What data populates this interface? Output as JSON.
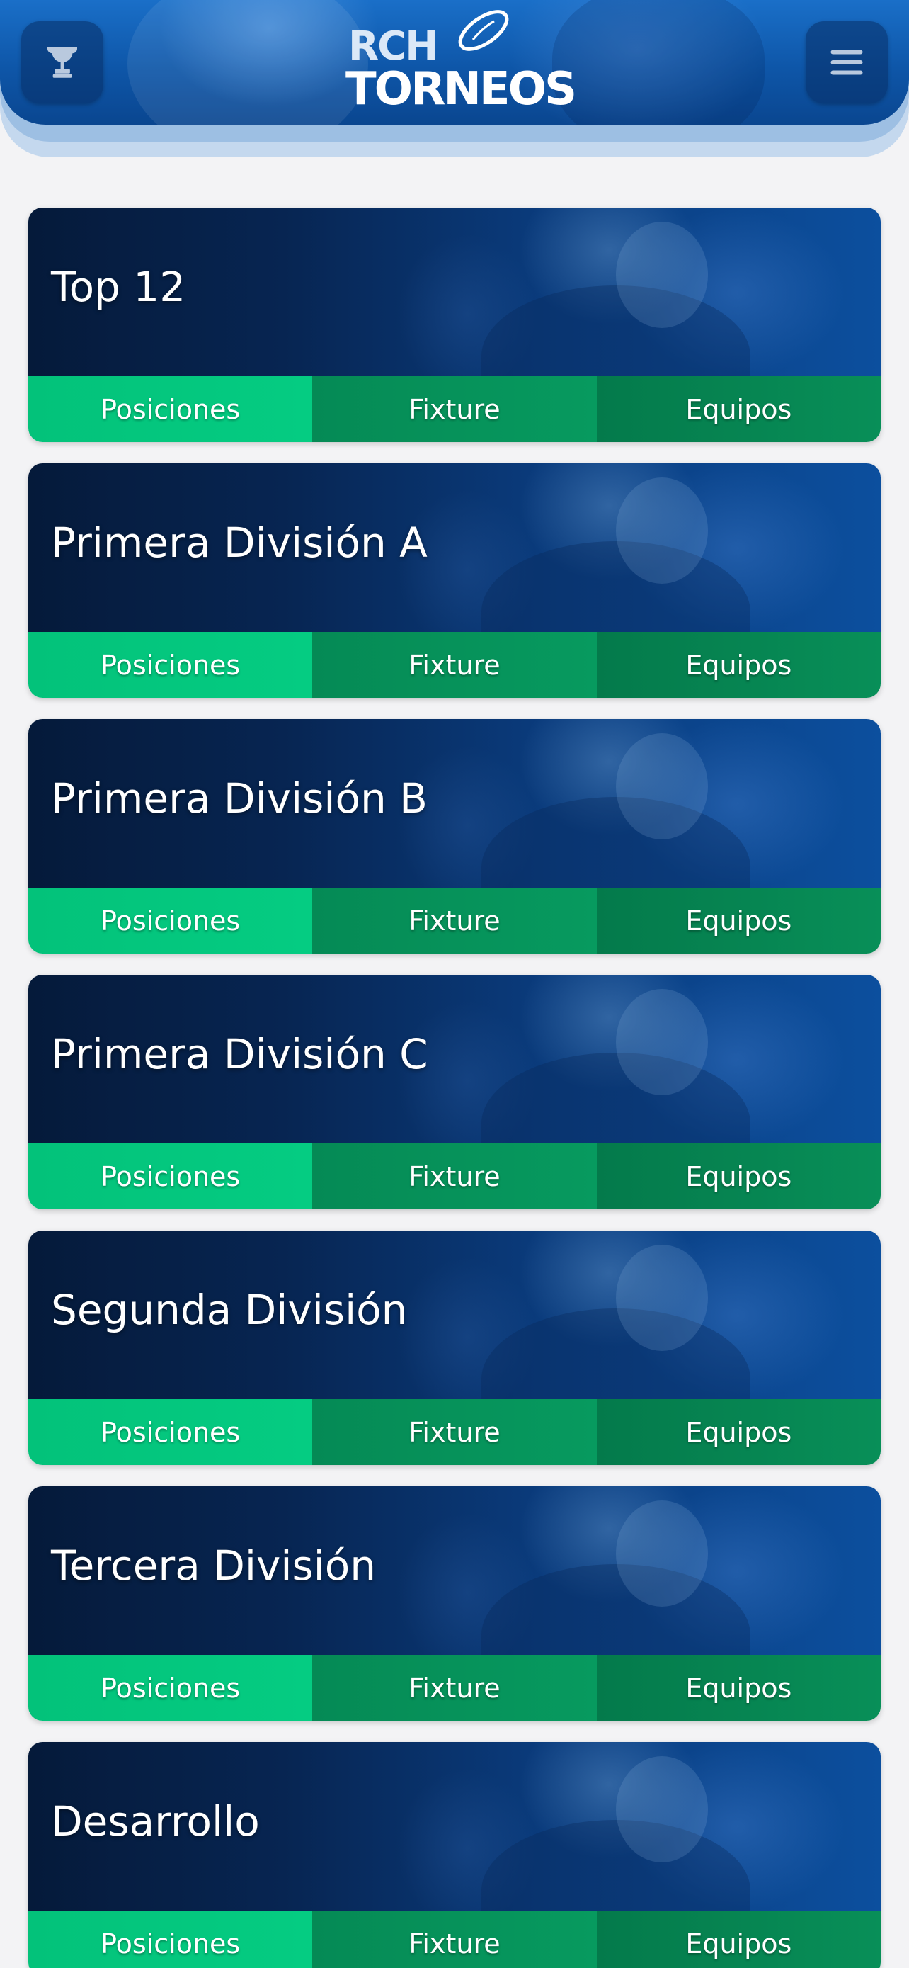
{
  "header": {
    "logo_top": "RCH",
    "logo_bottom": "TORNEOS",
    "left_icon": "trophy-icon",
    "right_icon": "hamburger-menu-icon"
  },
  "tournaments": [
    {
      "title": "Top 12",
      "tabs": [
        "Posiciones",
        "Fixture",
        "Equipos"
      ]
    },
    {
      "title": "Primera División A",
      "tabs": [
        "Posiciones",
        "Fixture",
        "Equipos"
      ]
    },
    {
      "title": "Primera División B",
      "tabs": [
        "Posiciones",
        "Fixture",
        "Equipos"
      ]
    },
    {
      "title": "Primera División C",
      "tabs": [
        "Posiciones",
        "Fixture",
        "Equipos"
      ]
    },
    {
      "title": "Segunda División",
      "tabs": [
        "Posiciones",
        "Fixture",
        "Equipos"
      ]
    },
    {
      "title": "Tercera División",
      "tabs": [
        "Posiciones",
        "Fixture",
        "Equipos"
      ]
    },
    {
      "title": "Desarrollo",
      "tabs": [
        "Posiciones",
        "Fixture",
        "Equipos"
      ]
    }
  ],
  "colors": {
    "header_blue": "#0e56a8",
    "card_dark": "#051a3a",
    "tab_green_light": "#05cc82",
    "tab_green_dark": "#058a55"
  }
}
